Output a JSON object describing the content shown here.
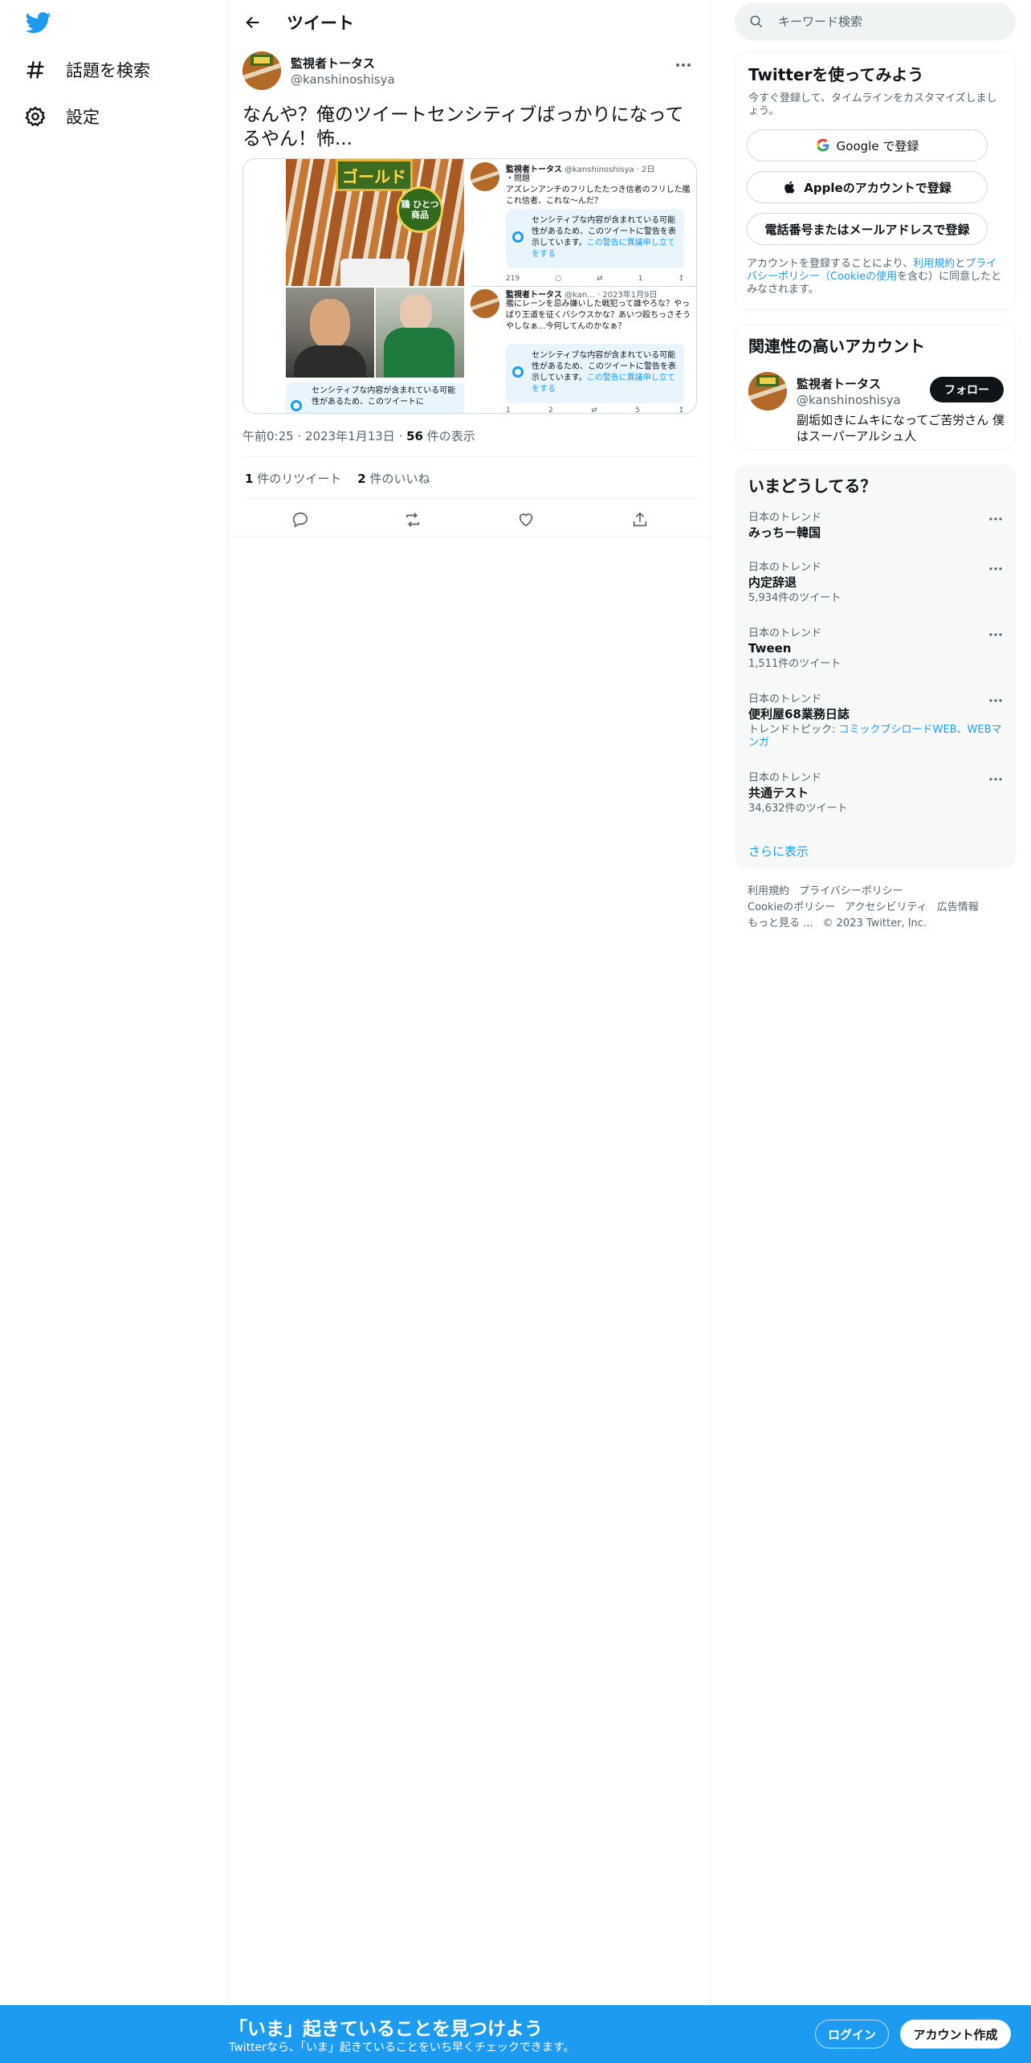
{
  "nav": {
    "items": [
      {
        "label": "話題を検索",
        "icon": "hashtag-icon"
      },
      {
        "label": "設定",
        "icon": "gear-icon"
      }
    ]
  },
  "header": {
    "title": "ツイート"
  },
  "tweet": {
    "author_name": "監視者トータス",
    "author_handle": "@kanshinoshisya",
    "text": "なんや？俺のツイートセンシティブばっかりになってるやん！怖...",
    "time": "午前0:25",
    "date": "2023年1月13日",
    "views_count": "56",
    "views_label": "件の表示",
    "retweets_count": "1",
    "retweets_label": "件のリツイート",
    "likes_count": "2",
    "likes_label": "件のいいね"
  },
  "media": {
    "food_label": "ゴールド",
    "food_badge": "鶏 ひとつ 商品",
    "left_sensitive": "センシティブな内容が含まれている可能性があるため、このツイートに",
    "post1_name": "監視者トータス",
    "post1_meta": "@kanshinoshisya · 2日",
    "post1_text": "アズレンアンチのフリしたたつき信者のフリした艦これ信者、これな〜んだ？",
    "post1_tag": "・問題",
    "post1_stat_views": "219",
    "post1_stat_likes": "1",
    "post2_name": "監視者トータス",
    "post2_meta": "@kan... · 2023年1月9日",
    "post2_text": "艦にレーンを忌み嫌いした戦犯って誰やろな？やっぱり王道を征くバシウスかな？あいつ殴ちっさそうやしなぁ...今何してんのかなぁ？",
    "post2_stat_views": "1",
    "post2_stat_replies": "2",
    "post2_stat_likes": "5",
    "sensitive_text": "センシティブな内容が含まれている可能性があるため、このツイートに警告を表示しています。",
    "sensitive_link": "この警告に異議申し立てをする"
  },
  "search": {
    "placeholder": "キーワード検索"
  },
  "signup": {
    "title": "Twitterを使ってみよう",
    "subtitle": "今すぐ登録して、タイムラインをカスタマイズしましょう。",
    "google_label": "Google で登録",
    "apple_label": "Appleのアカウントで登録",
    "phone_label": "電話番号またはメールアドレスで登録",
    "legal_pre": "アカウントを登録することにより、",
    "legal_terms": "利用規約",
    "legal_and": "と",
    "legal_privacy": "プライバシーポリシー（Cookieの使用",
    "legal_post": "を含む）に同意したとみなされます。"
  },
  "related": {
    "title": "関連性の高いアカウント",
    "name": "監視者トータス",
    "handle": "@kanshinoshisya",
    "bio": "副垢如きにムキになってご苦労さん 僕はスーパーアルシュ人",
    "follow_label": "フォロー"
  },
  "trends": {
    "title": "いまどうしてる？",
    "items": [
      {
        "context": "日本のトレンド",
        "name": "みっちー韓国",
        "count": ""
      },
      {
        "context": "日本のトレンド",
        "name": "内定辞退",
        "count": "5,934件のツイート"
      },
      {
        "context": "日本のトレンド",
        "name": "Tween",
        "count": "1,511件のツイート"
      },
      {
        "context": "日本のトレンド",
        "name": "便利屋68業務日誌",
        "topic_label": "トレンドトピック: ",
        "topic_link": "コミックブシロードWEB、WEBマンガ"
      },
      {
        "context": "日本のトレンド",
        "name": "共通テスト",
        "count": "34,632件のツイート"
      }
    ],
    "show_more": "さらに表示"
  },
  "footer": {
    "links": [
      "利用規約",
      "プライバシーポリシー",
      "Cookieのポリシー",
      "アクセシビリティ",
      "広告情報",
      "もっと見る ..."
    ],
    "copyright": "© 2023 Twitter, Inc."
  },
  "bottom_bar": {
    "title": "「いま」起きていることを見つけよう",
    "subtitle": "Twitterなら、「いま」起きていることをいち早くチェックできます。",
    "login_label": "ログイン",
    "signup_label": "アカウント作成"
  },
  "colors": {
    "brand": "#1d9bf0",
    "text": "#0f1419",
    "muted": "#536471"
  }
}
